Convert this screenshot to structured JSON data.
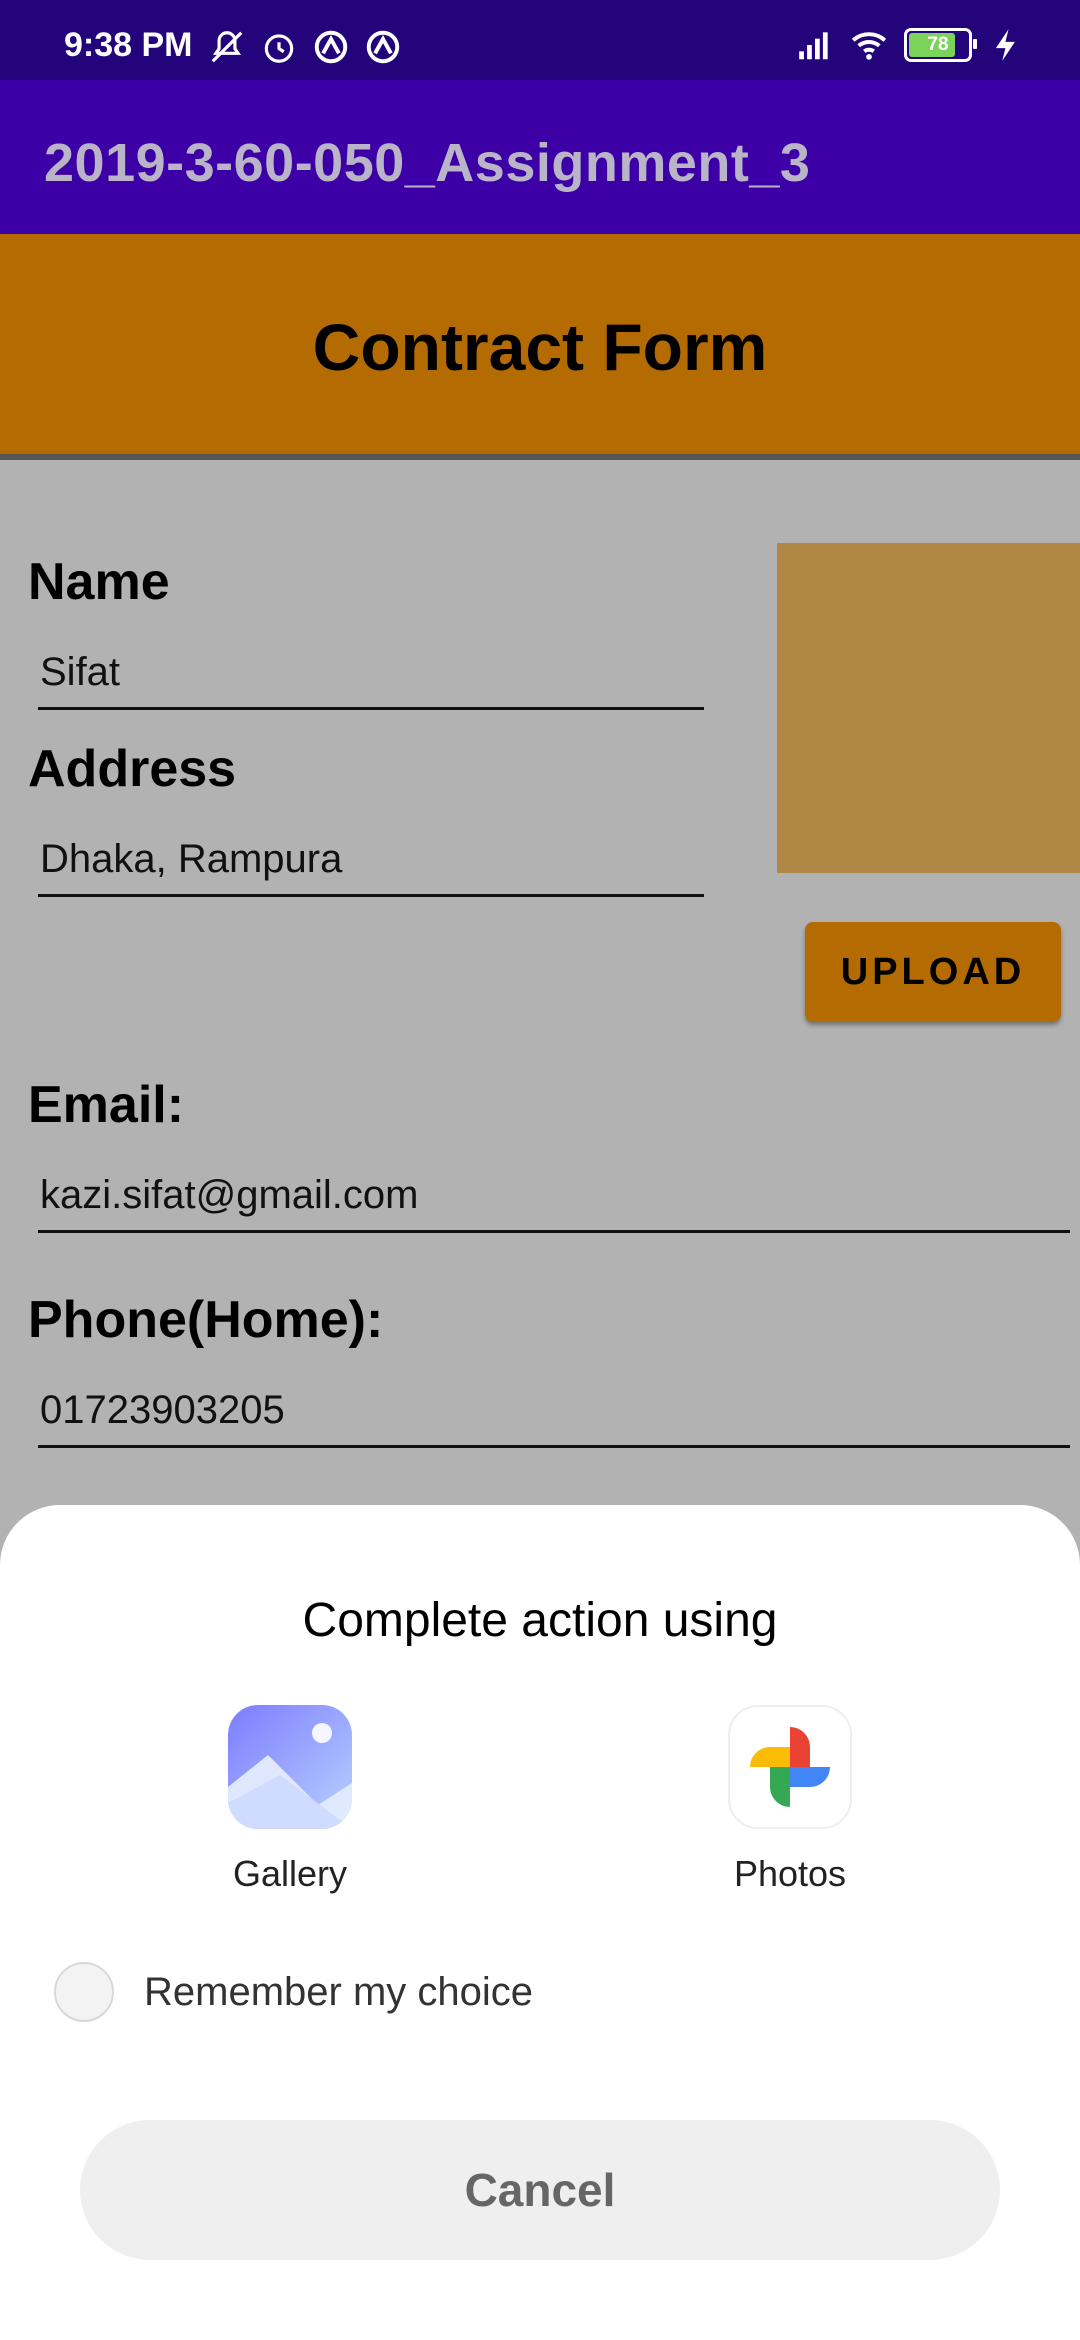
{
  "status_bar": {
    "time": "9:38 PM",
    "battery_level": "78",
    "icons_left": [
      "mute-icon",
      "alarm-icon",
      "vpn-icon",
      "vpn-icon"
    ],
    "icons_right": [
      "signal-icon",
      "wifi-icon",
      "battery-icon",
      "charging-icon"
    ]
  },
  "app_bar": {
    "title": "2019-3-60-050_Assignment_3"
  },
  "form": {
    "title": "Contract Form",
    "name_label": "Name",
    "name_value": "Sifat",
    "address_label": "Address",
    "address_value": "Dhaka, Rampura",
    "upload_label": "UPLOAD",
    "email_label": "Email:",
    "email_value": "kazi.sifat@gmail.com",
    "phone_label": "Phone(Home):",
    "phone_value": "01723903205"
  },
  "chooser": {
    "title": "Complete action using",
    "apps": [
      {
        "name": "Gallery",
        "icon": "gallery-icon"
      },
      {
        "name": "Photos",
        "icon": "photos-icon"
      }
    ],
    "remember_label": "Remember my choice",
    "remember_checked": false,
    "cancel_label": "Cancel"
  },
  "colors": {
    "status_bar": "#23047a",
    "app_bar": "#3d00a6",
    "header": "#b46b02",
    "photo_box": "#b08745",
    "scrim": "#b2b2b2"
  }
}
